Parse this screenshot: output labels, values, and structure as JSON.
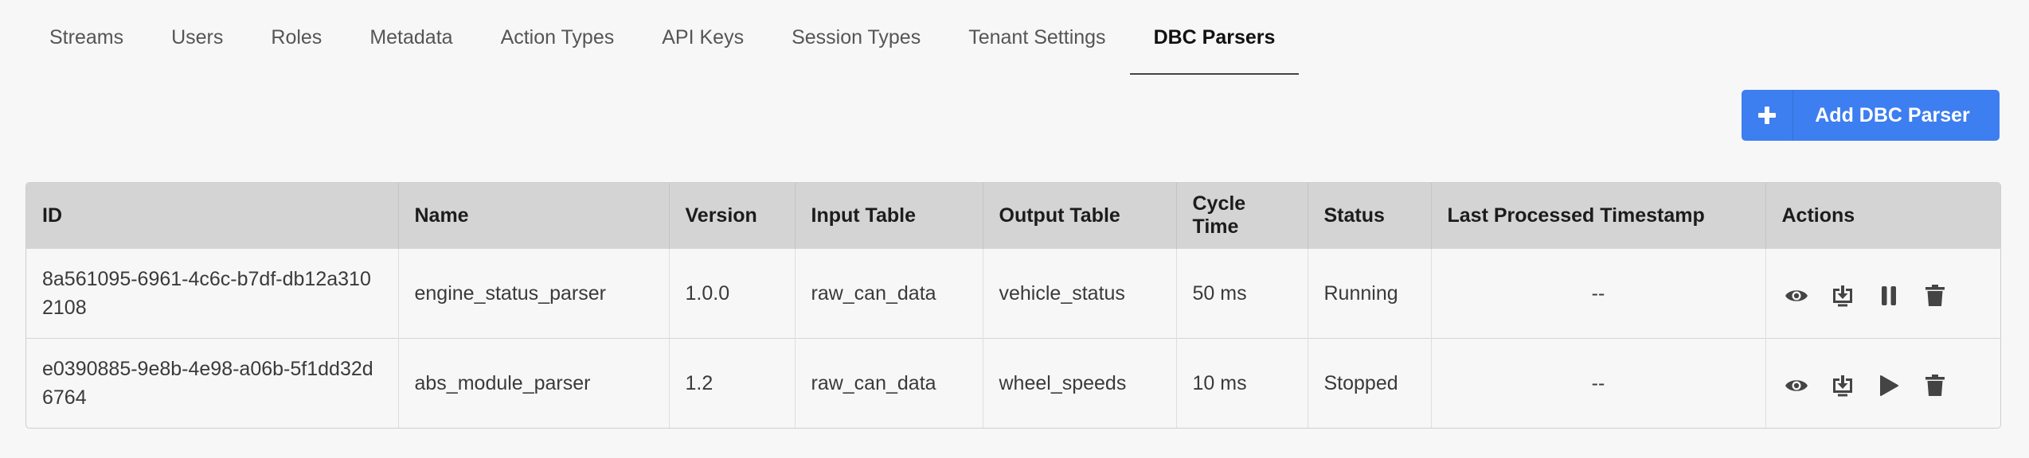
{
  "tabs": [
    {
      "label": "Streams"
    },
    {
      "label": "Users"
    },
    {
      "label": "Roles"
    },
    {
      "label": "Metadata"
    },
    {
      "label": "Action Types"
    },
    {
      "label": "API Keys"
    },
    {
      "label": "Session Types"
    },
    {
      "label": "Tenant Settings"
    },
    {
      "label": "DBC Parsers",
      "active": true
    }
  ],
  "add_button": {
    "label": "Add DBC Parser",
    "icon": "plus-icon",
    "color": "#3d7ef0"
  },
  "table": {
    "headers": [
      "ID",
      "Name",
      "Version",
      "Input Table",
      "Output Table",
      "Cycle Time",
      "Status",
      "Last Processed Timestamp",
      "Actions"
    ],
    "rows": [
      {
        "id": "8a561095-6961-4c6c-b7df-db12a3102108",
        "name": "engine_status_parser",
        "version": "1.0.0",
        "input_table": "raw_can_data",
        "output_table": "vehicle_status",
        "cycle_time": "50 ms",
        "status": "Running",
        "last_processed": "--",
        "actions": [
          "view-icon",
          "download-icon",
          "pause-icon",
          "delete-icon"
        ]
      },
      {
        "id": "e0390885-9e8b-4e98-a06b-5f1dd32d6764",
        "name": "abs_module_parser",
        "version": "1.2",
        "input_table": "raw_can_data",
        "output_table": "wheel_speeds",
        "cycle_time": "10 ms",
        "status": "Stopped",
        "last_processed": "--",
        "actions": [
          "view-icon",
          "download-icon",
          "play-icon",
          "delete-icon"
        ]
      }
    ]
  }
}
